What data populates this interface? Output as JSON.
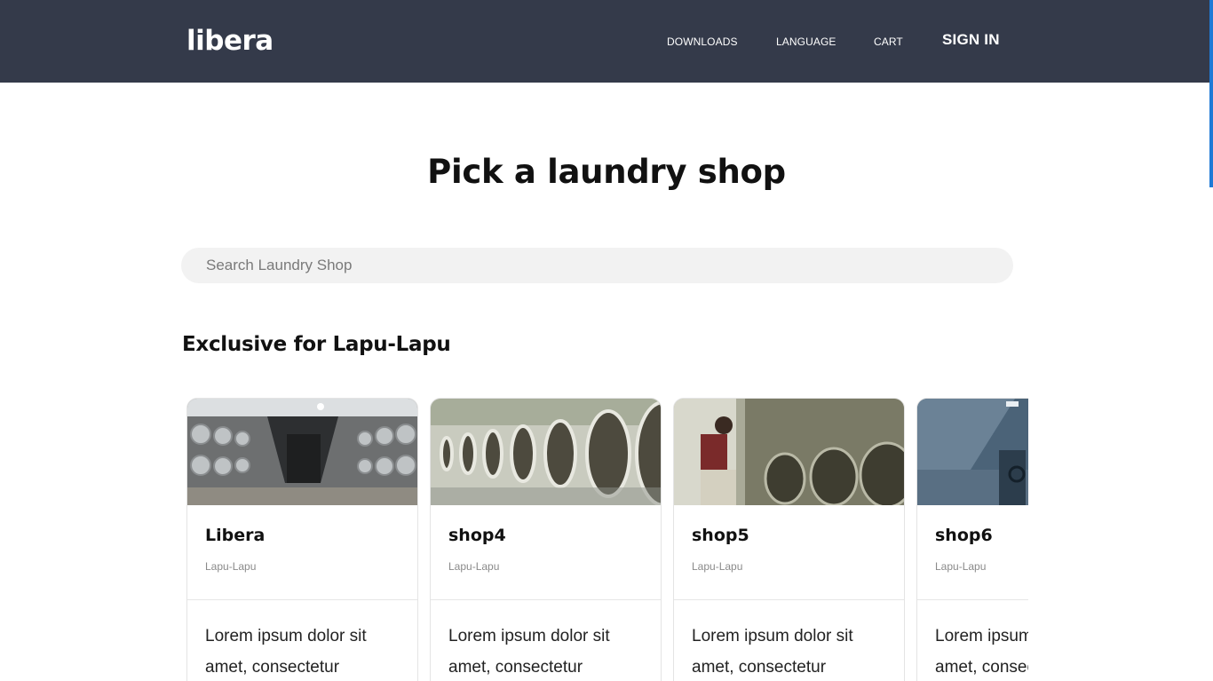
{
  "header": {
    "logo": "libera",
    "nav": {
      "downloads": "DOWNLOADS",
      "language": "LANGUAGE",
      "cart": "CART",
      "sign_in": "SIGN IN"
    }
  },
  "main": {
    "title": "Pick a laundry shop",
    "search_placeholder": "Search Laundry Shop",
    "section_title": "Exclusive for Lapu-Lapu",
    "shops": [
      {
        "name": "Libera",
        "location": "Lapu-Lapu",
        "description": "Lorem ipsum dolor sit amet, consectetur"
      },
      {
        "name": "shop4",
        "location": "Lapu-Lapu",
        "description": "Lorem ipsum dolor sit amet, consectetur"
      },
      {
        "name": "shop5",
        "location": "Lapu-Lapu",
        "description": "Lorem ipsum dolor sit amet, consectetur"
      },
      {
        "name": "shop6",
        "location": "Lapu-Lapu",
        "description": "Lorem ipsum dolor sit amet, consectetur"
      }
    ]
  },
  "colors": {
    "header_bg": "#343a4a",
    "scrollbar_accent": "#1f7ad6",
    "search_bg": "#f2f2f2"
  }
}
